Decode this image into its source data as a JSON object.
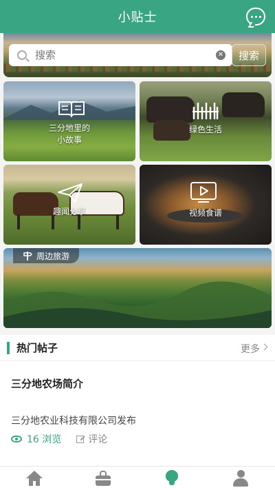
{
  "header": {
    "title": "小贴士"
  },
  "search": {
    "placeholder": "搜索",
    "button_label": "搜索"
  },
  "tiles": [
    {
      "label": "三分地里的\n小故事",
      "icon": "book-icon"
    },
    {
      "label": "绿色生活",
      "icon": "grass-icon"
    },
    {
      "label": "趣闻分享",
      "icon": "paper-plane-icon"
    },
    {
      "label": "视频食谱",
      "icon": "video-play-icon"
    },
    {
      "label": "周边旅游",
      "icon": "signpost-icon"
    }
  ],
  "hot": {
    "title": "热门帖子",
    "more_label": "更多"
  },
  "post": {
    "title": "三分地农场简介",
    "publisher": "三分地农业科技有限公司发布",
    "views": "16 浏览",
    "comment_label": "评论"
  },
  "nav": [
    "home-icon",
    "shop-bag-icon",
    "tips-bulb-icon",
    "user-icon"
  ],
  "colors": {
    "accent": "#3aa583"
  }
}
